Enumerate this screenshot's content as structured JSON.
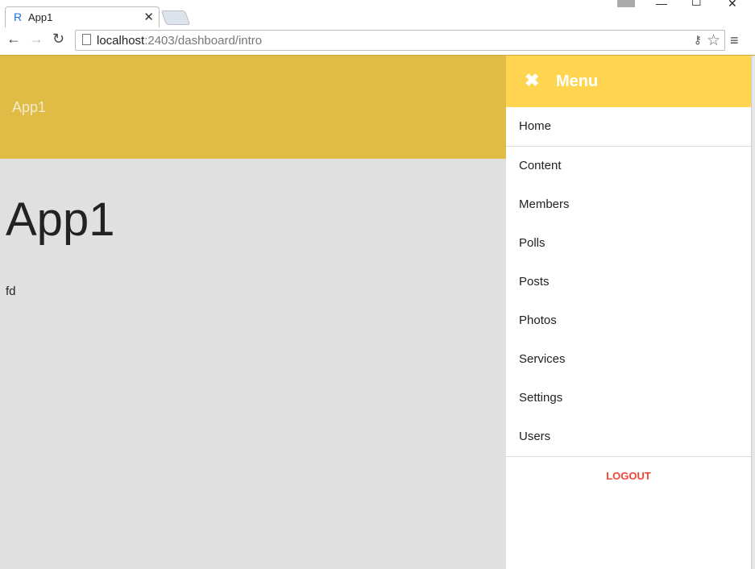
{
  "browser": {
    "tab_title": "App1",
    "url_host": "localhost",
    "url_rest": ":2403/dashboard/intro"
  },
  "app": {
    "toolbar_title": "App1",
    "heading": "App1",
    "body_text": "fd"
  },
  "drawer": {
    "title": "Menu",
    "items": [
      {
        "label": "Home"
      },
      {
        "label": "Content"
      },
      {
        "label": "Members"
      },
      {
        "label": "Polls"
      },
      {
        "label": "Posts"
      },
      {
        "label": "Photos"
      },
      {
        "label": "Services"
      },
      {
        "label": "Settings"
      },
      {
        "label": "Users"
      }
    ],
    "logout_label": "LOGOUT"
  },
  "colors": {
    "appbar": "#e0bb45",
    "drawer_header": "#ffd54f",
    "logout": "#f44336",
    "background": "#e0e0e0"
  }
}
